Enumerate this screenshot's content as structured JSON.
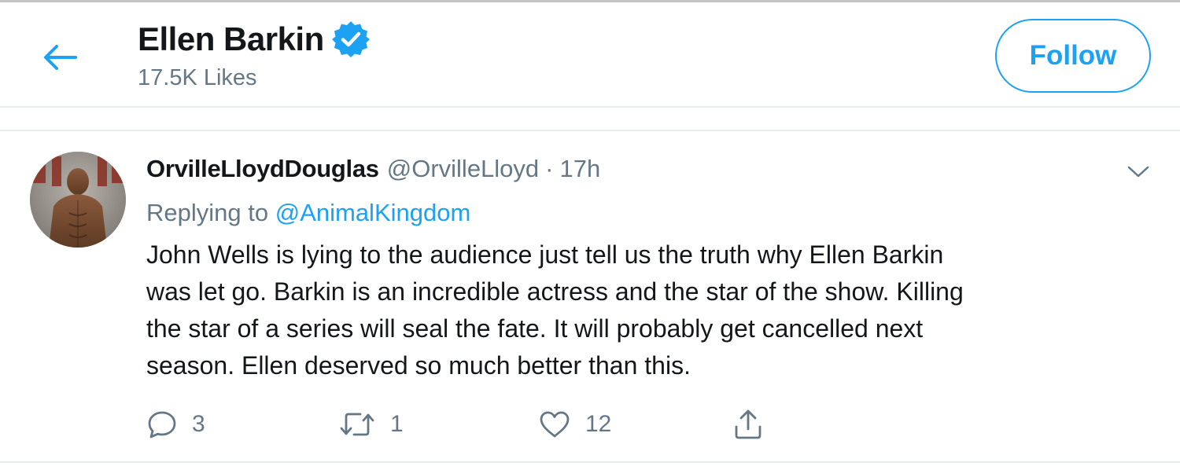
{
  "header": {
    "title": "Ellen Barkin",
    "subtitle": "17.5K Likes",
    "follow_label": "Follow",
    "icons": {
      "back": "arrow-left-icon",
      "verified": "verified-badge-icon"
    }
  },
  "tweet": {
    "author_name": "OrvilleLloydDouglas",
    "author_handle": "@OrvilleLloyd",
    "separator": "·",
    "time": "17h",
    "replying_prefix": "Replying to",
    "replying_mention": "@AnimalKingdom",
    "text_lines": [
      "John Wells is lying to the audience just tell us the truth why Ellen Barkin",
      "was let go. Barkin is an incredible actress and the star of the show. Killing",
      "the star of a series will seal the fate. It will probably get cancelled next",
      "season. Ellen deserved so much better than this."
    ],
    "actions": {
      "reply_count": "3",
      "retweet_count": "1",
      "like_count": "12"
    }
  },
  "colors": {
    "accent": "#1da1f2",
    "text": "#14171a",
    "secondary": "#657786",
    "border": "#e6ecf0"
  }
}
